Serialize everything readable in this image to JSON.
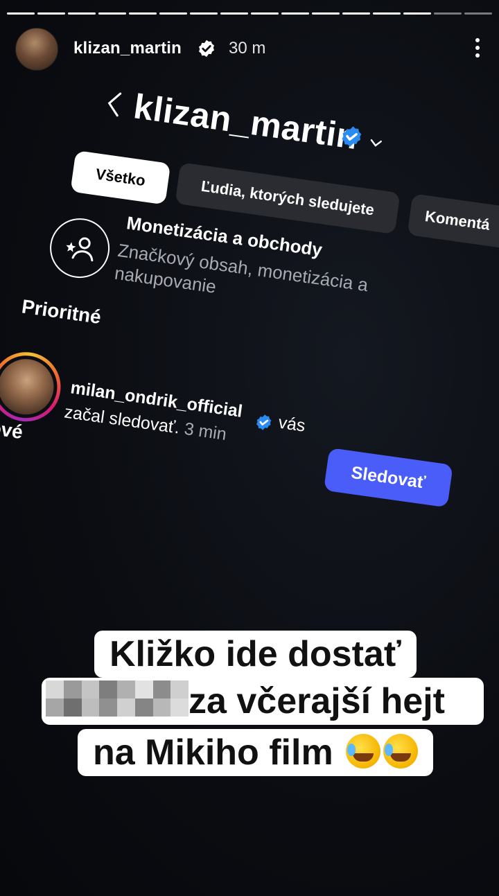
{
  "story": {
    "segments_total": 16,
    "segments_viewed": 14,
    "username": "klizan_martin",
    "verified": true,
    "time_ago": "30 m"
  },
  "screenshot": {
    "profile_username": "klizan_martin",
    "filters": [
      {
        "label": "Všetko",
        "active": true
      },
      {
        "label": "Ľudia, ktorých sledujete",
        "active": false
      },
      {
        "label": "Komentá",
        "active": false
      }
    ],
    "monetization": {
      "title": "Monetizácia a obchody",
      "subtitle": "Značkový obsah, monetizácia a nakupovanie"
    },
    "section_priority": "Prioritné",
    "notification": {
      "username": "milan_ondrik_official",
      "text_suffix": "vás",
      "line2": "začal sledovať.",
      "time": "3 min"
    },
    "section_new": "Nové",
    "follow_button": "Sledovať"
  },
  "caption": {
    "line1": "Kližko ide dostať",
    "line2": "za včerajší hejt",
    "line3": "na Mikiho film"
  },
  "colors": {
    "follow_blue": "#4a5df9",
    "verified_blue": "#2a8cf0"
  }
}
